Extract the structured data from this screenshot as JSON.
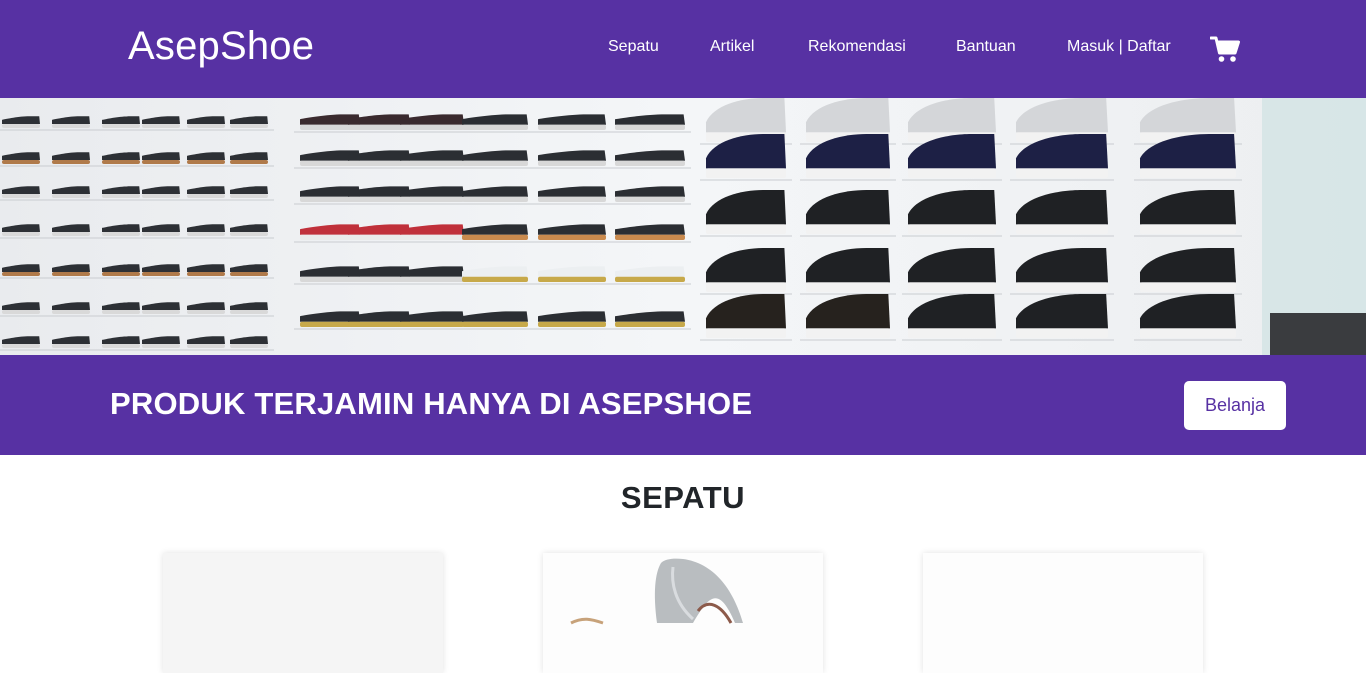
{
  "brand": "AsepShoe",
  "nav": {
    "items": [
      {
        "label": "Sepatu"
      },
      {
        "label": "Artikel"
      },
      {
        "label": "Rekomendasi"
      },
      {
        "label": "Bantuan"
      },
      {
        "label": "Masuk | Daftar"
      }
    ],
    "cart_icon": "shopping-cart-icon"
  },
  "banner": {
    "title": "PRODUK TERJAMIN HANYA DI ASEPSHOE",
    "button_label": "Belanja"
  },
  "section": {
    "title": "SEPATU"
  },
  "colors": {
    "primary": "#5731a3",
    "white": "#ffffff",
    "text": "#212529"
  }
}
